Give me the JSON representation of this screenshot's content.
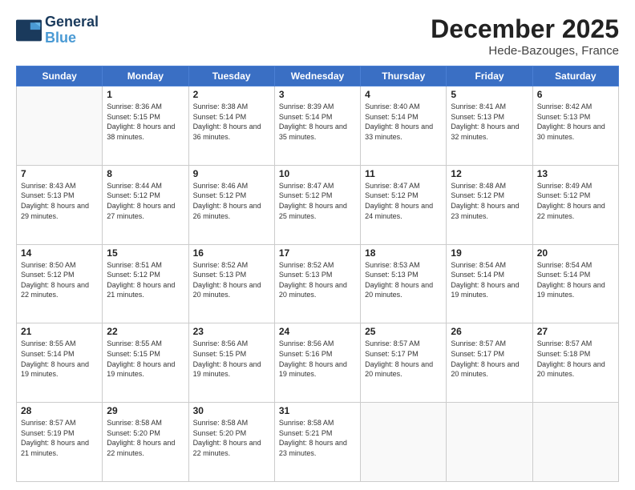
{
  "header": {
    "logo_line1": "General",
    "logo_line2": "Blue",
    "month_title": "December 2025",
    "location": "Hede-Bazouges, France"
  },
  "weekdays": [
    "Sunday",
    "Monday",
    "Tuesday",
    "Wednesday",
    "Thursday",
    "Friday",
    "Saturday"
  ],
  "weeks": [
    [
      {
        "day": "",
        "sunrise": "",
        "sunset": "",
        "daylight": ""
      },
      {
        "day": "1",
        "sunrise": "Sunrise: 8:36 AM",
        "sunset": "Sunset: 5:15 PM",
        "daylight": "Daylight: 8 hours and 38 minutes."
      },
      {
        "day": "2",
        "sunrise": "Sunrise: 8:38 AM",
        "sunset": "Sunset: 5:14 PM",
        "daylight": "Daylight: 8 hours and 36 minutes."
      },
      {
        "day": "3",
        "sunrise": "Sunrise: 8:39 AM",
        "sunset": "Sunset: 5:14 PM",
        "daylight": "Daylight: 8 hours and 35 minutes."
      },
      {
        "day": "4",
        "sunrise": "Sunrise: 8:40 AM",
        "sunset": "Sunset: 5:14 PM",
        "daylight": "Daylight: 8 hours and 33 minutes."
      },
      {
        "day": "5",
        "sunrise": "Sunrise: 8:41 AM",
        "sunset": "Sunset: 5:13 PM",
        "daylight": "Daylight: 8 hours and 32 minutes."
      },
      {
        "day": "6",
        "sunrise": "Sunrise: 8:42 AM",
        "sunset": "Sunset: 5:13 PM",
        "daylight": "Daylight: 8 hours and 30 minutes."
      }
    ],
    [
      {
        "day": "7",
        "sunrise": "Sunrise: 8:43 AM",
        "sunset": "Sunset: 5:13 PM",
        "daylight": "Daylight: 8 hours and 29 minutes."
      },
      {
        "day": "8",
        "sunrise": "Sunrise: 8:44 AM",
        "sunset": "Sunset: 5:12 PM",
        "daylight": "Daylight: 8 hours and 27 minutes."
      },
      {
        "day": "9",
        "sunrise": "Sunrise: 8:46 AM",
        "sunset": "Sunset: 5:12 PM",
        "daylight": "Daylight: 8 hours and 26 minutes."
      },
      {
        "day": "10",
        "sunrise": "Sunrise: 8:47 AM",
        "sunset": "Sunset: 5:12 PM",
        "daylight": "Daylight: 8 hours and 25 minutes."
      },
      {
        "day": "11",
        "sunrise": "Sunrise: 8:47 AM",
        "sunset": "Sunset: 5:12 PM",
        "daylight": "Daylight: 8 hours and 24 minutes."
      },
      {
        "day": "12",
        "sunrise": "Sunrise: 8:48 AM",
        "sunset": "Sunset: 5:12 PM",
        "daylight": "Daylight: 8 hours and 23 minutes."
      },
      {
        "day": "13",
        "sunrise": "Sunrise: 8:49 AM",
        "sunset": "Sunset: 5:12 PM",
        "daylight": "Daylight: 8 hours and 22 minutes."
      }
    ],
    [
      {
        "day": "14",
        "sunrise": "Sunrise: 8:50 AM",
        "sunset": "Sunset: 5:12 PM",
        "daylight": "Daylight: 8 hours and 22 minutes."
      },
      {
        "day": "15",
        "sunrise": "Sunrise: 8:51 AM",
        "sunset": "Sunset: 5:12 PM",
        "daylight": "Daylight: 8 hours and 21 minutes."
      },
      {
        "day": "16",
        "sunrise": "Sunrise: 8:52 AM",
        "sunset": "Sunset: 5:13 PM",
        "daylight": "Daylight: 8 hours and 20 minutes."
      },
      {
        "day": "17",
        "sunrise": "Sunrise: 8:52 AM",
        "sunset": "Sunset: 5:13 PM",
        "daylight": "Daylight: 8 hours and 20 minutes."
      },
      {
        "day": "18",
        "sunrise": "Sunrise: 8:53 AM",
        "sunset": "Sunset: 5:13 PM",
        "daylight": "Daylight: 8 hours and 20 minutes."
      },
      {
        "day": "19",
        "sunrise": "Sunrise: 8:54 AM",
        "sunset": "Sunset: 5:14 PM",
        "daylight": "Daylight: 8 hours and 19 minutes."
      },
      {
        "day": "20",
        "sunrise": "Sunrise: 8:54 AM",
        "sunset": "Sunset: 5:14 PM",
        "daylight": "Daylight: 8 hours and 19 minutes."
      }
    ],
    [
      {
        "day": "21",
        "sunrise": "Sunrise: 8:55 AM",
        "sunset": "Sunset: 5:14 PM",
        "daylight": "Daylight: 8 hours and 19 minutes."
      },
      {
        "day": "22",
        "sunrise": "Sunrise: 8:55 AM",
        "sunset": "Sunset: 5:15 PM",
        "daylight": "Daylight: 8 hours and 19 minutes."
      },
      {
        "day": "23",
        "sunrise": "Sunrise: 8:56 AM",
        "sunset": "Sunset: 5:15 PM",
        "daylight": "Daylight: 8 hours and 19 minutes."
      },
      {
        "day": "24",
        "sunrise": "Sunrise: 8:56 AM",
        "sunset": "Sunset: 5:16 PM",
        "daylight": "Daylight: 8 hours and 19 minutes."
      },
      {
        "day": "25",
        "sunrise": "Sunrise: 8:57 AM",
        "sunset": "Sunset: 5:17 PM",
        "daylight": "Daylight: 8 hours and 20 minutes."
      },
      {
        "day": "26",
        "sunrise": "Sunrise: 8:57 AM",
        "sunset": "Sunset: 5:17 PM",
        "daylight": "Daylight: 8 hours and 20 minutes."
      },
      {
        "day": "27",
        "sunrise": "Sunrise: 8:57 AM",
        "sunset": "Sunset: 5:18 PM",
        "daylight": "Daylight: 8 hours and 20 minutes."
      }
    ],
    [
      {
        "day": "28",
        "sunrise": "Sunrise: 8:57 AM",
        "sunset": "Sunset: 5:19 PM",
        "daylight": "Daylight: 8 hours and 21 minutes."
      },
      {
        "day": "29",
        "sunrise": "Sunrise: 8:58 AM",
        "sunset": "Sunset: 5:20 PM",
        "daylight": "Daylight: 8 hours and 22 minutes."
      },
      {
        "day": "30",
        "sunrise": "Sunrise: 8:58 AM",
        "sunset": "Sunset: 5:20 PM",
        "daylight": "Daylight: 8 hours and 22 minutes."
      },
      {
        "day": "31",
        "sunrise": "Sunrise: 8:58 AM",
        "sunset": "Sunset: 5:21 PM",
        "daylight": "Daylight: 8 hours and 23 minutes."
      },
      {
        "day": "",
        "sunrise": "",
        "sunset": "",
        "daylight": ""
      },
      {
        "day": "",
        "sunrise": "",
        "sunset": "",
        "daylight": ""
      },
      {
        "day": "",
        "sunrise": "",
        "sunset": "",
        "daylight": ""
      }
    ]
  ]
}
